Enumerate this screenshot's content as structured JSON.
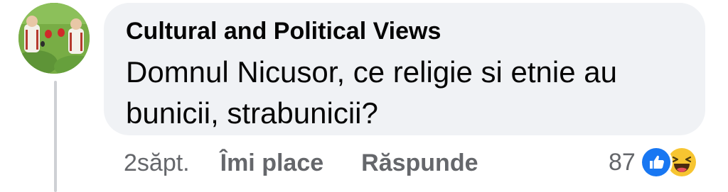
{
  "comment": {
    "author": "Cultural and Political Views",
    "text": "Domnul Nicusor, ce religie si etnie au bunicii, strabunicii?",
    "time": "2săpt.",
    "like_label": "Îmi place",
    "reply_label": "Răspunde",
    "reaction_count": "87",
    "reactions": [
      "like-icon",
      "haha-icon"
    ]
  },
  "colors": {
    "bubble_bg": "#f0f2f5",
    "text": "#050505",
    "secondary_text": "#65676b",
    "like_blue": "#1877f2",
    "haha_yellow": "#f7c531"
  }
}
